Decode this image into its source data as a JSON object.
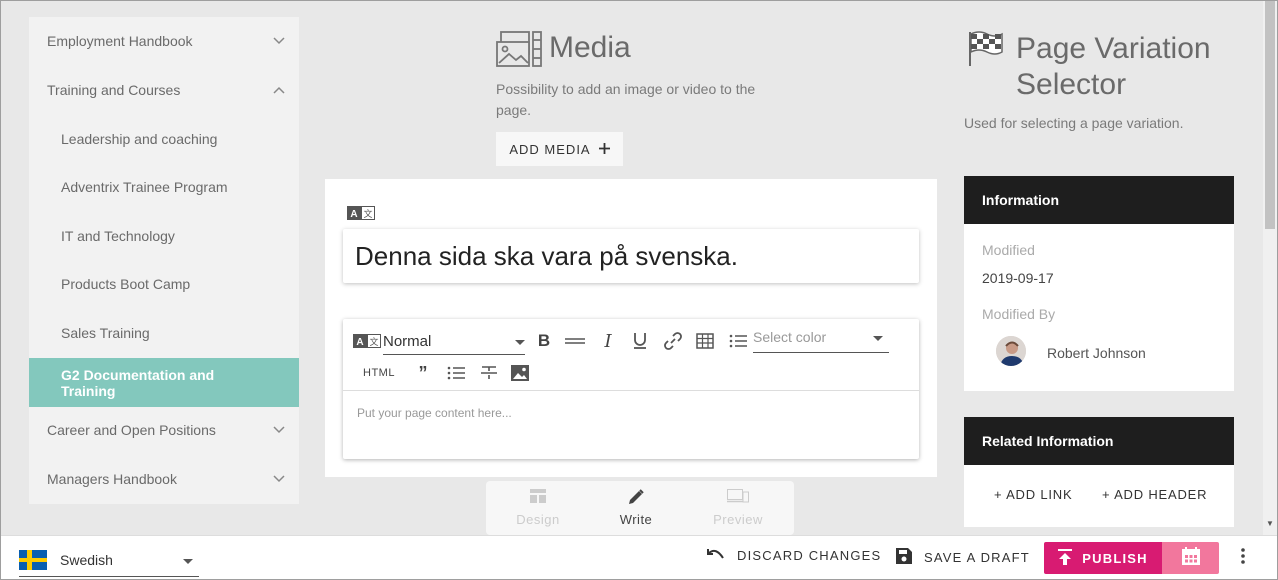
{
  "sidebar": {
    "items": [
      {
        "label": "Employment Handbook",
        "level": "top",
        "expanded": false
      },
      {
        "label": "Training and Courses",
        "level": "top",
        "expanded": true
      },
      {
        "label": "Leadership and coaching",
        "level": "sub"
      },
      {
        "label": "Adventrix Trainee Program",
        "level": "sub"
      },
      {
        "label": "IT and Technology",
        "level": "sub"
      },
      {
        "label": "Products Boot Camp",
        "level": "sub"
      },
      {
        "label": "Sales Training",
        "level": "sub"
      },
      {
        "label": "G2 Documentation and Training",
        "level": "sub",
        "active": true
      },
      {
        "label": "Career and Open Positions",
        "level": "top",
        "expanded": false
      },
      {
        "label": "Managers Handbook",
        "level": "top",
        "expanded": false
      }
    ]
  },
  "media": {
    "title": "Media",
    "description": "Possibility to add an image or video to the page.",
    "add_button": "ADD MEDIA",
    "add_icon": "plus-icon"
  },
  "editor": {
    "page_title": "Denna sida ska vara på svenska.",
    "format_value": "Normal",
    "color_placeholder": "Select color",
    "html_label": "HTML",
    "content_placeholder": "Put your page content here..."
  },
  "modes": {
    "design": "Design",
    "write": "Write",
    "preview": "Preview",
    "active": "write"
  },
  "variation": {
    "title": "Page Variation Selector",
    "description": "Used for selecting a page variation."
  },
  "info": {
    "header": "Information",
    "modified_label": "Modified",
    "modified_value": "2019-09-17",
    "modified_by_label": "Modified By",
    "author": "Robert Johnson"
  },
  "related": {
    "header": "Related Information",
    "add_link": "+ ADD LINK",
    "add_header": "+ ADD HEADER"
  },
  "bottom": {
    "language": "Swedish",
    "discard": "DISCARD CHANGES",
    "save_draft": "SAVE A DRAFT",
    "publish": "PUBLISH"
  },
  "colors": {
    "active_nav": "#83c8bd",
    "publish": "#d81b72",
    "schedule": "#f2779d",
    "card_header": "#1e1e1e"
  }
}
